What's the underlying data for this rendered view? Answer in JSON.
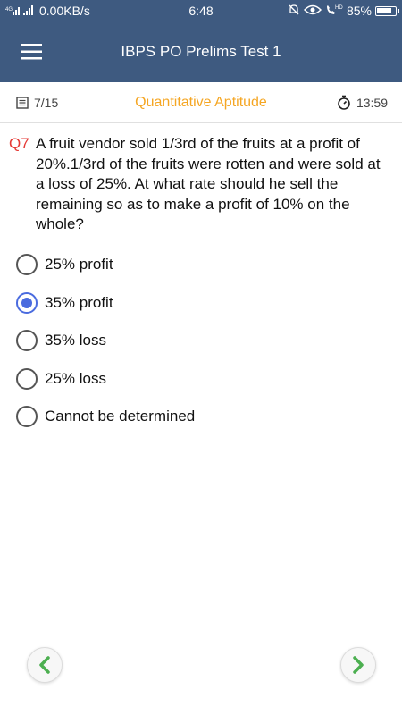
{
  "status_bar": {
    "network_speed": "0.00KB/s",
    "time": "6:48",
    "battery": "85%",
    "icons": [
      "signal-icon",
      "silent-icon",
      "eye-icon",
      "hd-call-icon",
      "battery-icon"
    ]
  },
  "header": {
    "title": "IBPS PO Prelims Test 1",
    "menu_icon": "hamburger-icon"
  },
  "info_bar": {
    "progress": "7/15",
    "section": "Quantitative Aptitude",
    "timer": "13:59"
  },
  "question": {
    "number": "Q7",
    "text": "A fruit vendor sold 1/3rd of the fruits at a profit of 20%.1/3rd of the fruits were rotten and were sold at a loss of 25%. At what rate should he sell the remaining so as to make a profit of 10% on the whole?"
  },
  "options": [
    {
      "label": "25% profit",
      "selected": false
    },
    {
      "label": "35% profit",
      "selected": true
    },
    {
      "label": "35% loss",
      "selected": false
    },
    {
      "label": "25% loss",
      "selected": false
    },
    {
      "label": "Cannot be determined",
      "selected": false
    }
  ],
  "colors": {
    "header": "#3e5a80",
    "section": "#f5a623",
    "question_number": "#e53935",
    "radio_selected": "#4a6bdf",
    "nav_arrow": "#4caf50"
  }
}
